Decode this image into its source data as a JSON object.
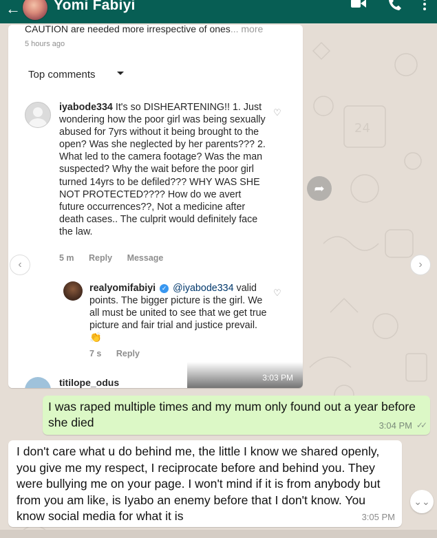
{
  "header": {
    "back_icon": "arrow-left-icon",
    "contact_name": "Yomi Fabiyi",
    "icons": [
      "video-call-icon",
      "phone-icon",
      "more-vert-icon"
    ],
    "background_color": "#075e54"
  },
  "image_message": {
    "caution_text": "CAUTION are needed more irrespective of ones",
    "caution_more": "... more",
    "posted_ago": "5 hours ago",
    "top_comments_label": "Top comments",
    "comment": {
      "username": "iyabode334",
      "text": " It's so DISHEARTENING!! 1. Just wondering how the poor girl was being sexually abused for 7yrs without it being brought to the open? Was she neglected by her parents??? 2. What led to the camera footage? Was the man suspected? Why the wait before the poor girl turned 14yrs to be defiled??? WHY WAS SHE NOT PROTECTED???? How do we avert future occurrences??, Not a medicine after death cases.. The culprit would definitely face the law.",
      "time": "5 m",
      "reply_label": "Reply",
      "message_label": "Message"
    },
    "reply": {
      "username": "realyomifabiyi",
      "mention": "@iyabode334",
      "text": " valid points. The bigger picture is the girl. We all must be united to see that we get true picture and fair trial and justice prevail. 👏",
      "time": "7 s",
      "reply_label": "Reply"
    },
    "next_username": "titilope_odus",
    "timestamp": "3:03 PM"
  },
  "outgoing_message": {
    "text": "I was raped multiple times and my mum only found out a year before she died",
    "time": "3:04 PM",
    "status": "✓✓"
  },
  "incoming_message": {
    "text": "I don't care what u do behind me, the little I know we shared openly, you give me my respect, I reciprocate before and behind you. They were bullying me on your page. I won't mind if it is from anybody but from you am like, is Iyabo an enemy before that I don't know. You know social media for what it is",
    "time": "3:05 PM"
  },
  "colors": {
    "wallpaper": "#e5ddd5",
    "outgoing_bubble": "#dcf8c6",
    "incoming_bubble": "#ffffff"
  }
}
